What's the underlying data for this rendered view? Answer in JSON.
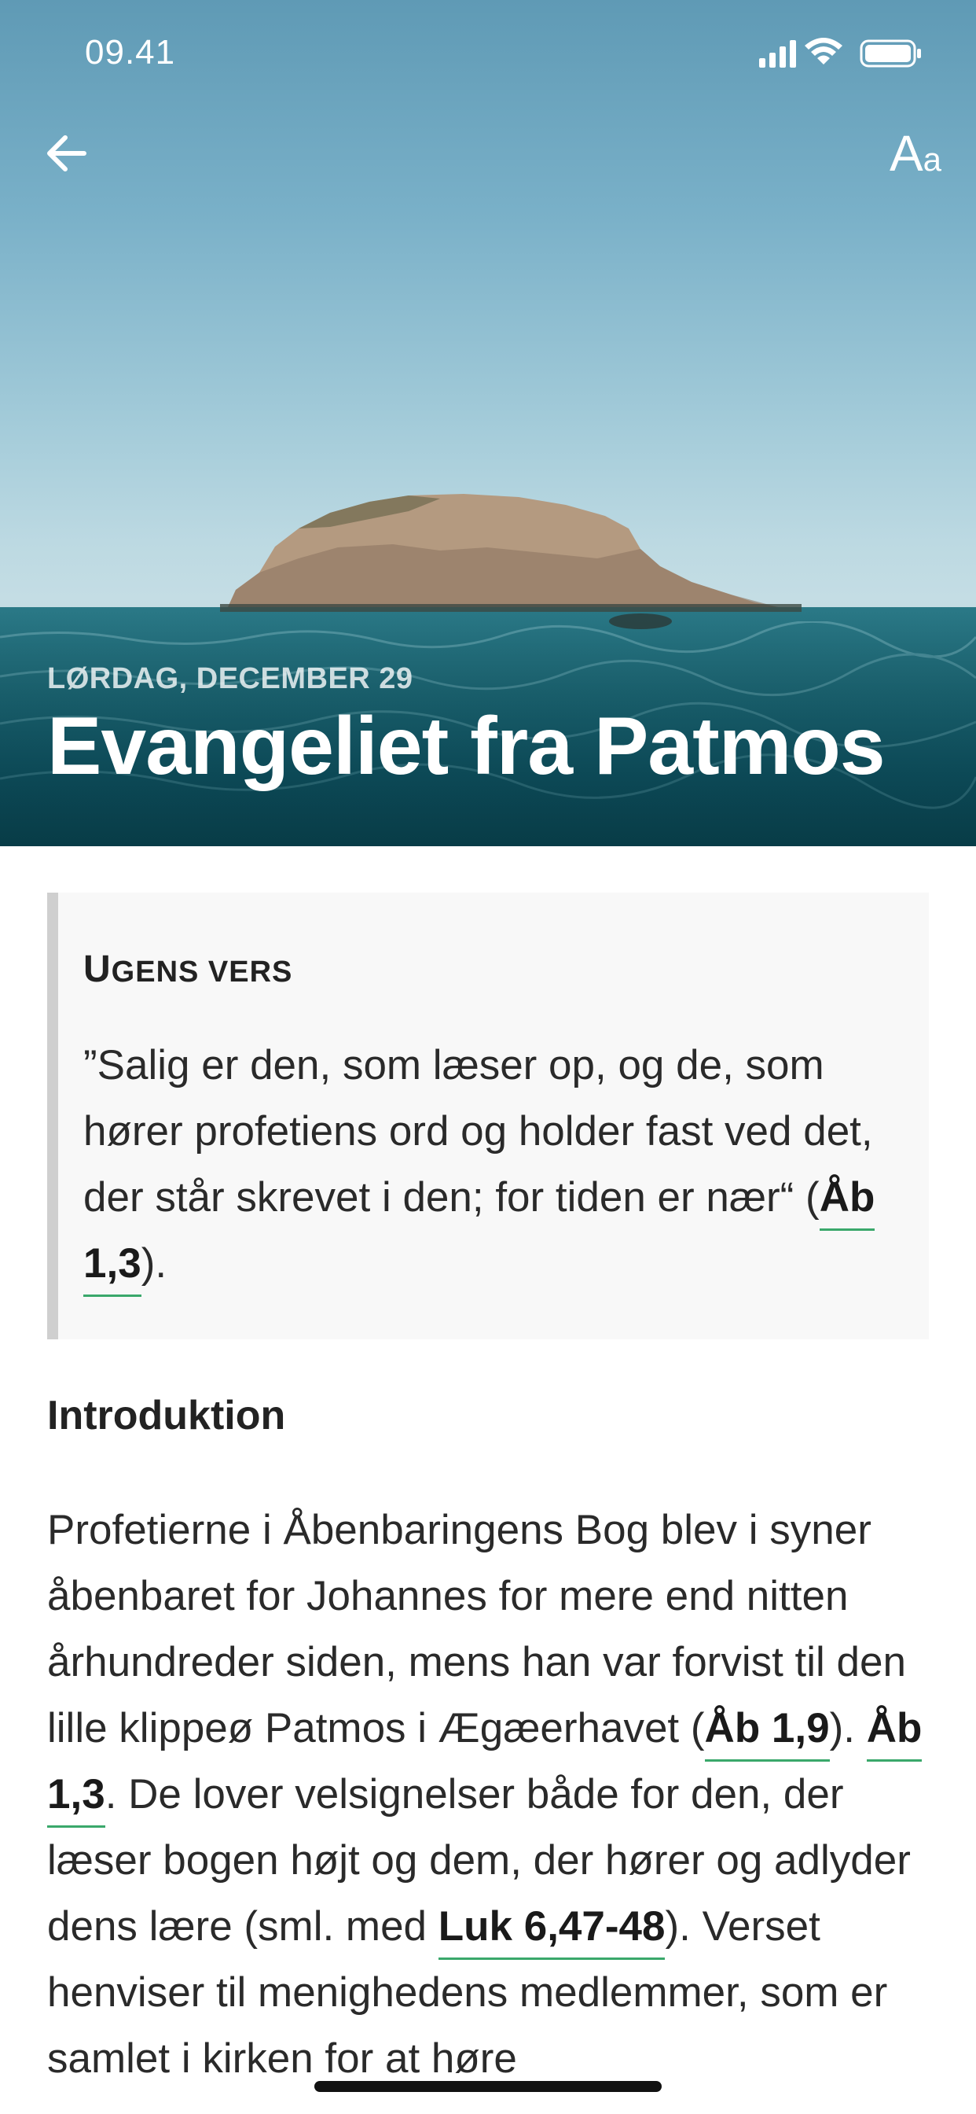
{
  "status_bar": {
    "time": "09.41",
    "icons": [
      "signal-icon",
      "wifi-icon",
      "battery-icon"
    ]
  },
  "header": {
    "back_icon": "arrow-left-icon",
    "font_size_label_big": "A",
    "font_size_label_small": "a"
  },
  "hero": {
    "date": "LØRDAG, DECEMBER 29",
    "title": "Evangeliet fra Patmos"
  },
  "verse": {
    "heading_first": "U",
    "heading_rest": "GENS VERS",
    "text_before": "”Salig er den, som læser op, og de, som hører profetiens ord og holder fast ved det, der står skrevet i den; for tiden er nær“ (",
    "reference": "Åb 1,3",
    "text_after": ")."
  },
  "intro": {
    "heading": "Introduktion",
    "p1": "Profetierne i Åbenbaringens Bog blev i syner åbenbaret for Johannes for mere end nitten århundreder siden, mens han var forvist til den lille klippeø Patmos i Ægæerhavet (",
    "ref1": "Åb 1,9",
    "p2": "). ",
    "ref2": "Åb 1,3",
    "p3": ". De lover velsignelser både for den, der læser bogen højt og dem, der hører og adlyder dens lære (sml. med ",
    "ref3": "Luk 6,47-48",
    "p4": "). Verset henviser til menighedens medlemmer, som er samlet i kirken for at høre"
  },
  "colors": {
    "link_underline": "#3aa86b",
    "verse_box_bg": "#f8f8f8",
    "verse_box_border": "#cfcfcf"
  }
}
